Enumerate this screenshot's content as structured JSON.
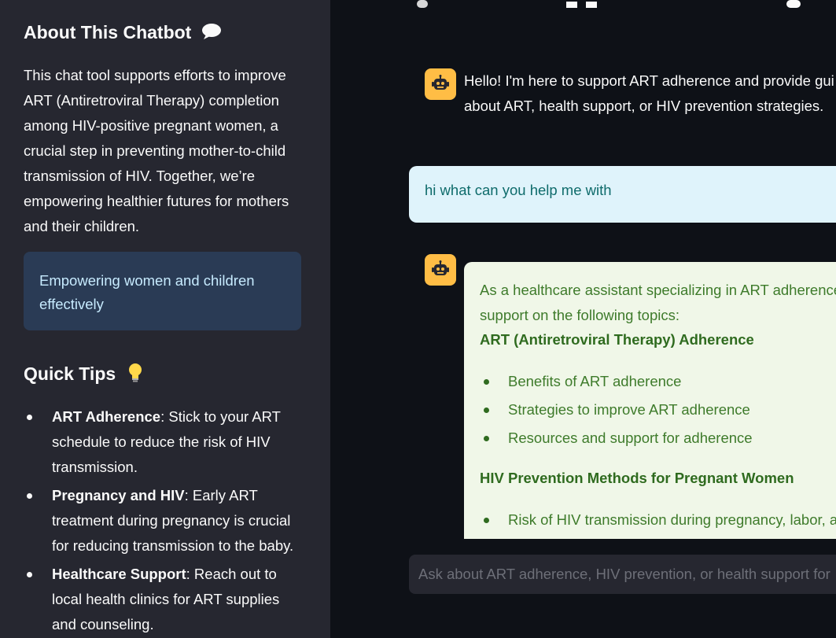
{
  "sidebar": {
    "title": "About This Chatbot",
    "title_icon": "speech-bubble-icon",
    "about": "This chat tool supports efforts to improve ART (Antiretroviral Therapy) completion among HIV-positive pregnant women, a crucial step in preventing mother-to-child transmission of HIV. Together, we’re empowering healthier futures for mothers and their children.",
    "info_box": "Empowering women and children effectively",
    "tips_title": "Quick Tips",
    "tips_icon": "lightbulb-icon",
    "tips": [
      {
        "bold": "ART Adherence",
        "text": ": Stick to your ART schedule to reduce the risk of HIV transmission."
      },
      {
        "bold": "Pregnancy and HIV",
        "text": ": Early ART treatment during pregnancy is crucial for reducing transmission to the baby."
      },
      {
        "bold": "Healthcare Support",
        "text": ": Reach out to local health clinics for ART supplies and counseling."
      }
    ]
  },
  "chat": {
    "bot_greeting_line1": "Hello! I'm here to support ART adherence and provide gui",
    "bot_greeting_line2": "about ART, health support, or HIV prevention strategies.",
    "user_message": "hi what can you help me with",
    "bot_reply": {
      "intro_line1": "As a healthcare assistant specializing in ART adherence",
      "intro_line2": "support on the following topics:",
      "section1_title": "ART (Antiretroviral Therapy) Adherence",
      "section1_items": [
        "Benefits of ART adherence",
        "Strategies to improve ART adherence",
        "Resources and support for adherence"
      ],
      "section2_title": "HIV Prevention Methods for Pregnant Women",
      "section2_items": [
        "Risk of HIV transmission during pregnancy, labor, a"
      ]
    },
    "input_placeholder": "Ask about ART adherence, HIV prevention, or health support for",
    "colors": {
      "avatar": "#ffbd45",
      "user_bubble": "#dff3fb",
      "bot_bubble": "#f0f7e8",
      "sidebar_bg": "#262730",
      "main_bg": "#0e1117"
    }
  }
}
